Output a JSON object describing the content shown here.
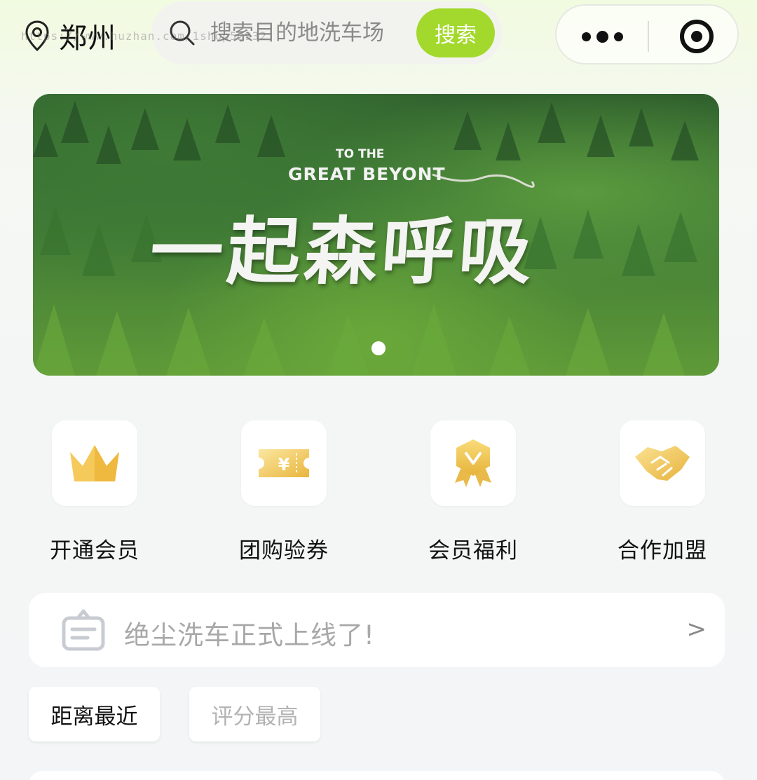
{
  "header": {
    "city": "郑州",
    "search_placeholder": "搜索目的地洗车场",
    "search_button": "搜索",
    "watermark": "https://www.huzhan.com/1shop52932"
  },
  "banner": {
    "line1": "TO THE",
    "line2": "GREAT BEYONT",
    "title": "一起森呼吸",
    "slide_count": 1,
    "active_slide": 1
  },
  "entries": [
    {
      "label": "开通会员",
      "icon": "crown-icon"
    },
    {
      "label": "团购验券",
      "icon": "coupon-icon"
    },
    {
      "label": "会员福利",
      "icon": "badge-icon"
    },
    {
      "label": "合作加盟",
      "icon": "handshake-icon"
    }
  ],
  "notice": {
    "text": "绝尘洗车正式上线了!",
    "arrow": ">"
  },
  "sort": {
    "options": [
      "距离最近",
      "评分最高"
    ],
    "selected": "距离最近"
  },
  "colors": {
    "accent": "#a3d92c",
    "gold": "#f2c655",
    "muted_text": "#a8a8a8"
  }
}
